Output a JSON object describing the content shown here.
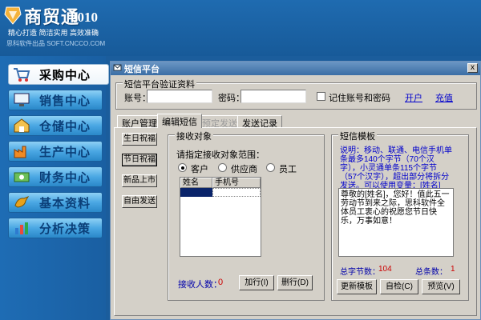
{
  "app": {
    "title": "商贸通",
    "version": "2010",
    "slogan": "精心打造  简洁实用  高效准确",
    "company": "思科软件出品  SOFT.CNCCO.COM"
  },
  "nav": {
    "items": [
      {
        "label": "采购中心",
        "icon": "cart-icon",
        "active": true
      },
      {
        "label": "销售中心",
        "icon": "monitor-icon",
        "active": false
      },
      {
        "label": "仓储中心",
        "icon": "warehouse-icon",
        "active": false
      },
      {
        "label": "生产中心",
        "icon": "factory-icon",
        "active": false
      },
      {
        "label": "财务中心",
        "icon": "money-icon",
        "active": false
      },
      {
        "label": "基本资料",
        "icon": "bird-icon",
        "active": false
      },
      {
        "label": "分析决策",
        "icon": "chart-icon",
        "active": false
      }
    ]
  },
  "dialog": {
    "title": "短信平台",
    "close": "x",
    "verify": {
      "legend": "短信平台验证资料",
      "account_label": "账号：",
      "account_value": "",
      "password_label": "密码：",
      "password_value": "",
      "remember_label": "记住账号和密码",
      "register_link": "开户",
      "recharge_link": "充值"
    },
    "tabs": [
      {
        "label": "账户管理"
      },
      {
        "label": "编辑短信"
      },
      {
        "label": "预定发送"
      },
      {
        "label": "发送记录"
      }
    ],
    "side_buttons": [
      "生日祝福",
      "节日祝福",
      "新品上市",
      "自由发送"
    ],
    "recipients": {
      "legend": "接收对象",
      "range_label": "请指定接收对象范围：",
      "options": [
        "客户",
        "供应商",
        "员工"
      ],
      "columns": [
        "姓名",
        "手机号"
      ],
      "count_label": "接收人数：",
      "count_value": "0",
      "add_button": "加行(I)",
      "delete_button": "删行(D)"
    },
    "template": {
      "legend": "短信模板",
      "description": "说明：移动、联通、电信手机单条最多140个字节（70个汉字），小灵通单条115个字节（57个汉字），超出部分将拆分发送。可以使用变量：[姓名]",
      "body": "尊敬的[姓名]，您好！值此五一劳动节到来之际，思科软件全体员工衷心的祝愿您节日快乐，万事如意！",
      "bytes_label": "总字节数：",
      "bytes_value": "104",
      "count_label": "总条数：",
      "count_value": "1",
      "update_button": "更新模板",
      "check_button": "自检(C)",
      "preview_button": "预览(V)"
    }
  }
}
